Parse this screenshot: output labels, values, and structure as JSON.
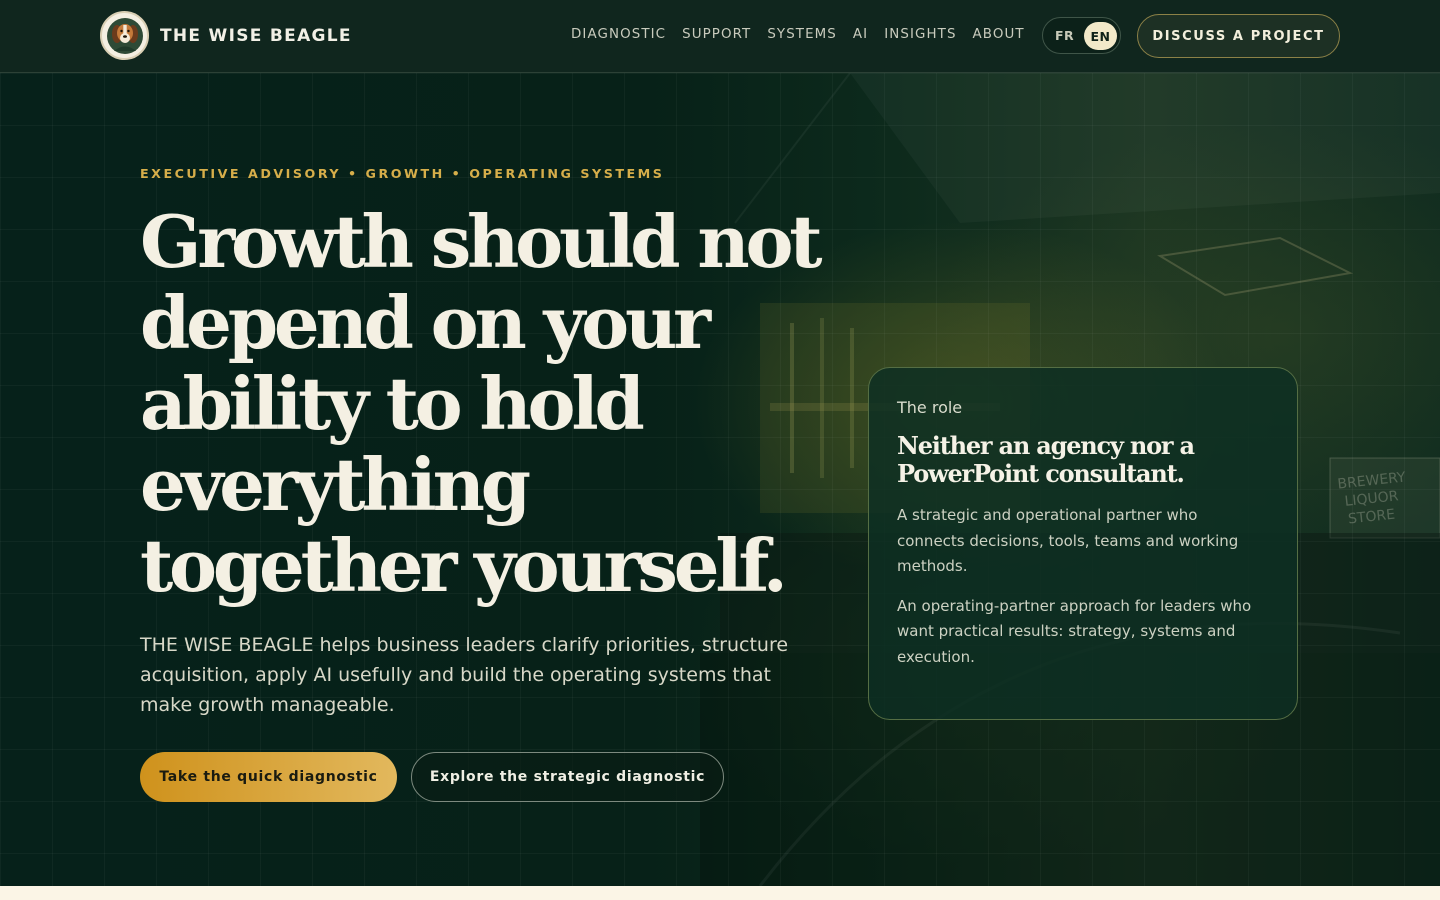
{
  "header": {
    "brand": "THE WISE BEAGLE",
    "nav": [
      {
        "label": "DIAGNOSTIC"
      },
      {
        "label": "SUPPORT"
      },
      {
        "label": "SYSTEMS"
      },
      {
        "label": "AI"
      },
      {
        "label": "INSIGHTS"
      },
      {
        "label": "ABOUT"
      }
    ],
    "lang": {
      "fr": "FR",
      "en": "EN",
      "active": "EN"
    },
    "cta": "DISCUSS A PROJECT"
  },
  "hero": {
    "eyebrow": "EXECUTIVE ADVISORY • GROWTH • OPERATING SYSTEMS",
    "headline": "Growth should not depend on your ability to hold everything together yourself.",
    "lede": "THE WISE BEAGLE helps business leaders clarify priorities, structure acquisition, apply AI usefully and build the operating systems that make growth manageable.",
    "primary_cta": "Take the quick diagnostic",
    "secondary_cta": "Explore the strategic diagnostic"
  },
  "role_card": {
    "eyebrow": "The role",
    "title": "Neither an agency nor a PowerPoint consultant.",
    "p1": "A strategic and operational partner who connects decisions, tools, teams and working methods.",
    "p2": "An operating-partner approach for leaders who want practical results: strategy, systems and execution."
  },
  "colors": {
    "background": "#061a14",
    "accent_gold": "#d6ae4a",
    "header_bg": "#10261e",
    "cream": "#f4f0e3"
  },
  "icons": {
    "logo": "beagle-logo-icon"
  }
}
